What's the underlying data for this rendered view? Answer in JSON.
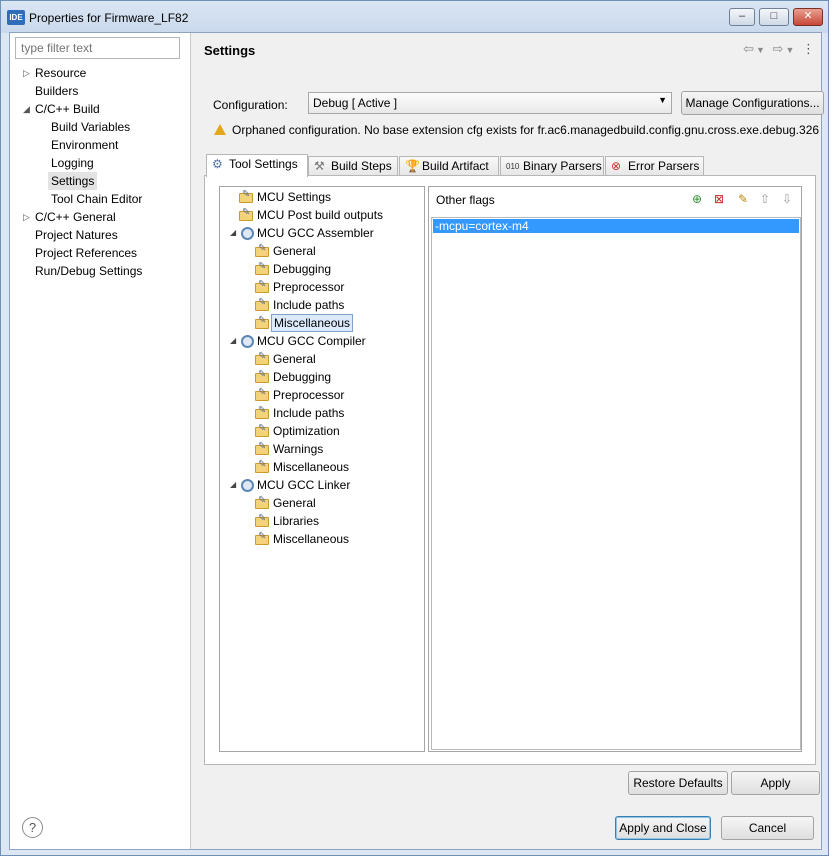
{
  "window": {
    "title": "Properties for Firmware_LF82",
    "app_icon": "IDE",
    "controls": [
      "minimize-icon",
      "maximize-icon",
      "close-icon"
    ]
  },
  "sidebar": {
    "filter_placeholder": "type filter text",
    "items": [
      {
        "label": "Resource",
        "expander": "collapsed"
      },
      {
        "label": "Builders",
        "expander": "none"
      },
      {
        "label": "C/C++ Build",
        "expander": "expanded"
      },
      {
        "label": "Build Variables",
        "expander": "none"
      },
      {
        "label": "Environment",
        "expander": "none"
      },
      {
        "label": "Logging",
        "expander": "none"
      },
      {
        "label": "Settings",
        "expander": "none",
        "selected": true
      },
      {
        "label": "Tool Chain Editor",
        "expander": "none"
      },
      {
        "label": "C/C++ General",
        "expander": "collapsed"
      },
      {
        "label": "Project Natures",
        "expander": "none"
      },
      {
        "label": "Project References",
        "expander": "none"
      },
      {
        "label": "Run/Debug Settings",
        "expander": "none"
      }
    ]
  },
  "main": {
    "title": "Settings",
    "configuration_label": "Configuration:",
    "configuration_value": "Debug  [ Active ]",
    "manage_button": "Manage Configurations...",
    "warning": "Orphaned configuration. No base extension cfg exists for fr.ac6.managedbuild.config.gnu.cross.exe.debug.326",
    "tabs": [
      {
        "label": "Tool Settings",
        "icon": "tool-settings-icon",
        "active": true
      },
      {
        "label": "Build Steps",
        "icon": "build-steps-icon"
      },
      {
        "label": "Build Artifact",
        "icon": "build-artifact-icon"
      },
      {
        "label": "Binary Parsers",
        "icon": "binary-parsers-icon"
      },
      {
        "label": "Error Parsers",
        "icon": "error-parsers-icon"
      }
    ],
    "tree": [
      {
        "label": "MCU Settings",
        "type": "option"
      },
      {
        "label": "MCU Post build outputs",
        "type": "option"
      },
      {
        "label": "MCU GCC Assembler",
        "type": "tool"
      },
      {
        "label": "General",
        "type": "category"
      },
      {
        "label": "Debugging",
        "type": "category"
      },
      {
        "label": "Preprocessor",
        "type": "category"
      },
      {
        "label": "Include paths",
        "type": "category"
      },
      {
        "label": "Miscellaneous",
        "type": "category",
        "selected": true
      },
      {
        "label": "MCU GCC Compiler",
        "type": "tool"
      },
      {
        "label": "General",
        "type": "category"
      },
      {
        "label": "Debugging",
        "type": "category"
      },
      {
        "label": "Preprocessor",
        "type": "category"
      },
      {
        "label": "Include paths",
        "type": "category"
      },
      {
        "label": "Optimization",
        "type": "category"
      },
      {
        "label": "Warnings",
        "type": "category"
      },
      {
        "label": "Miscellaneous",
        "type": "category"
      },
      {
        "label": "MCU GCC Linker",
        "type": "tool"
      },
      {
        "label": "General",
        "type": "category"
      },
      {
        "label": "Libraries",
        "type": "category"
      },
      {
        "label": "Miscellaneous",
        "type": "category"
      }
    ],
    "options_label": "Other flags",
    "options_toolbar": [
      "add-icon",
      "delete-icon",
      "edit-icon",
      "move-up-icon",
      "move-down-icon"
    ],
    "options_values": [
      "-mcpu=cortex-m4"
    ]
  },
  "buttons": {
    "restore_defaults": "Restore Defaults",
    "apply": "Apply",
    "apply_and_close": "Apply and Close",
    "cancel": "Cancel"
  }
}
